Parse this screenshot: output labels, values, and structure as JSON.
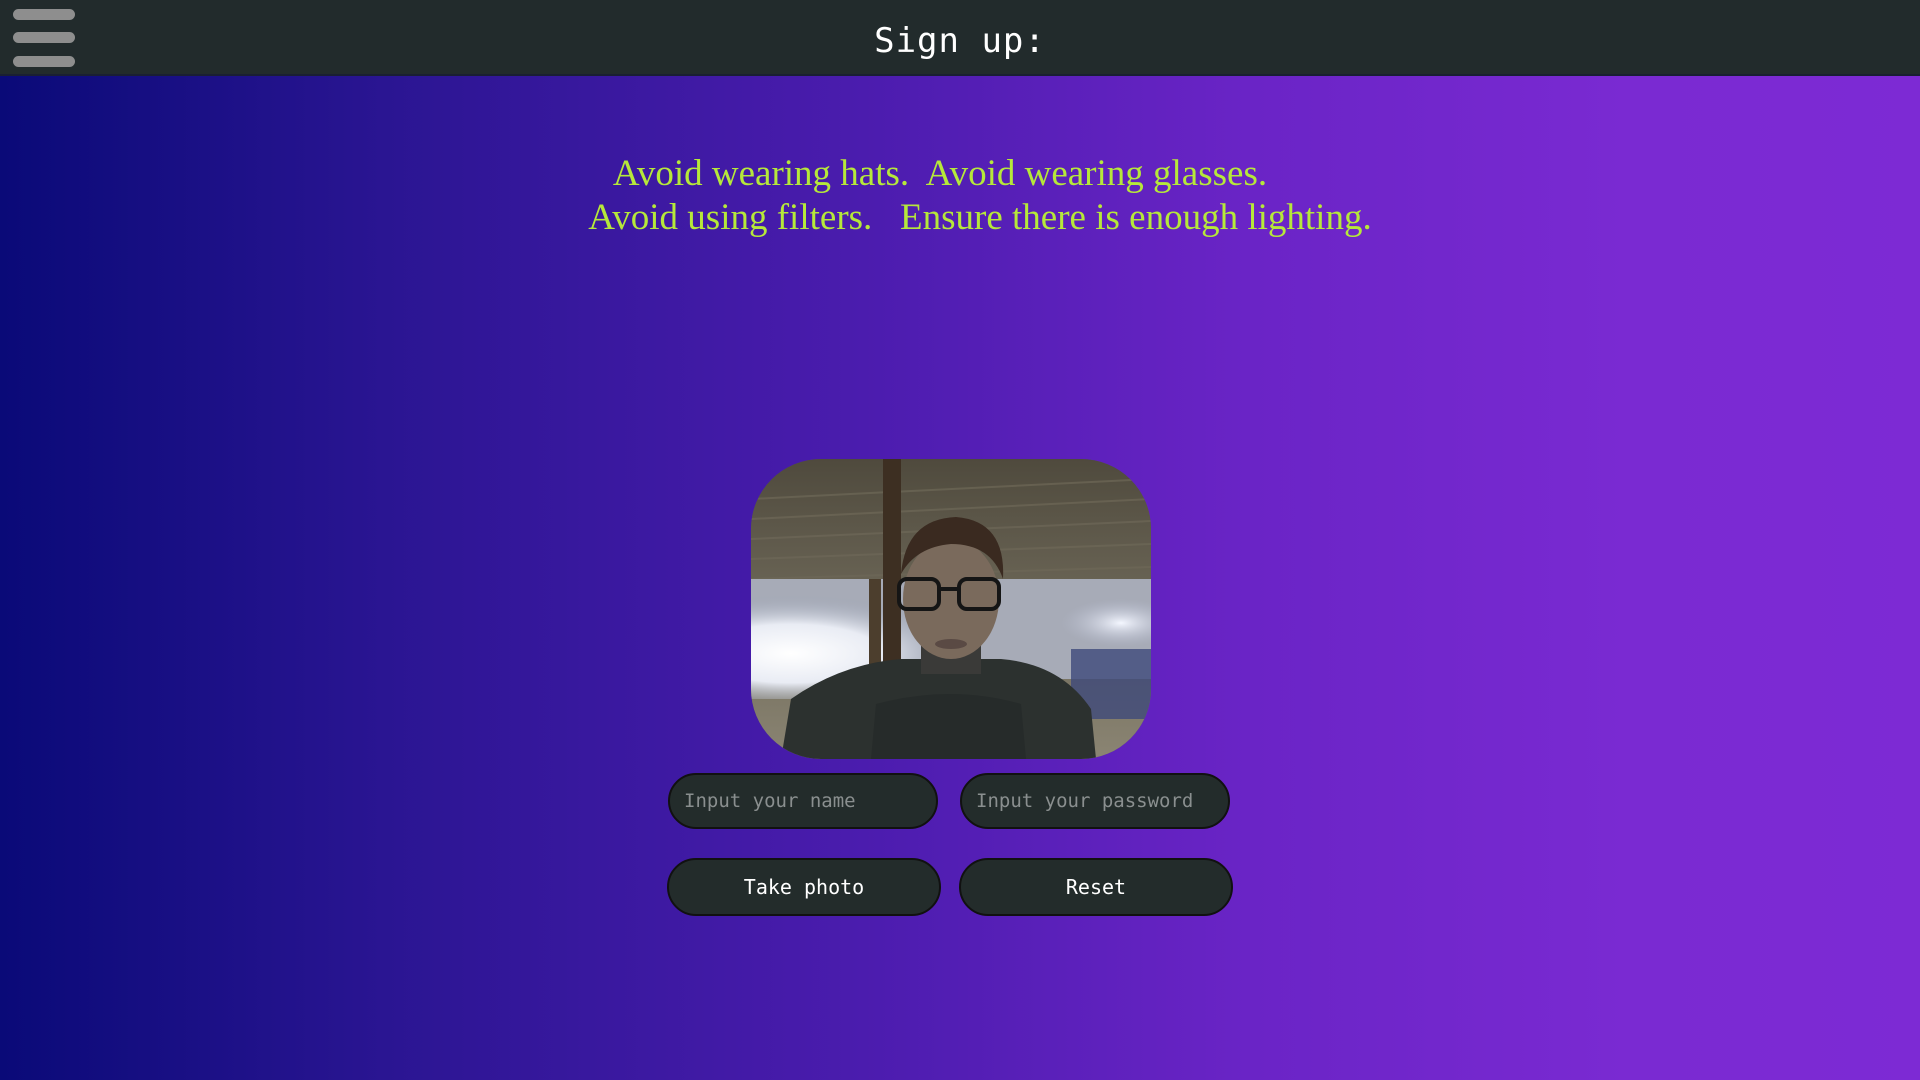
{
  "header": {
    "title": "Sign up:",
    "menu_icon": "hamburger-menu-icon"
  },
  "tips": {
    "line1": "Avoid wearing hats.  Avoid wearing glasses.",
    "line2": "Avoid using filters.   Ensure there is enough lighting."
  },
  "camera": {
    "icon": "webcam-preview"
  },
  "form": {
    "name_placeholder": "Input your name",
    "password_placeholder": "Input your password",
    "take_photo_label": "Take photo",
    "reset_label": "Reset"
  },
  "colors": {
    "header_bg": "#222b2c",
    "tips_text": "#b6e83a",
    "gradient_start": "#0a0a78",
    "gradient_end": "#7d2ad4",
    "control_bg": "#232c2b"
  }
}
